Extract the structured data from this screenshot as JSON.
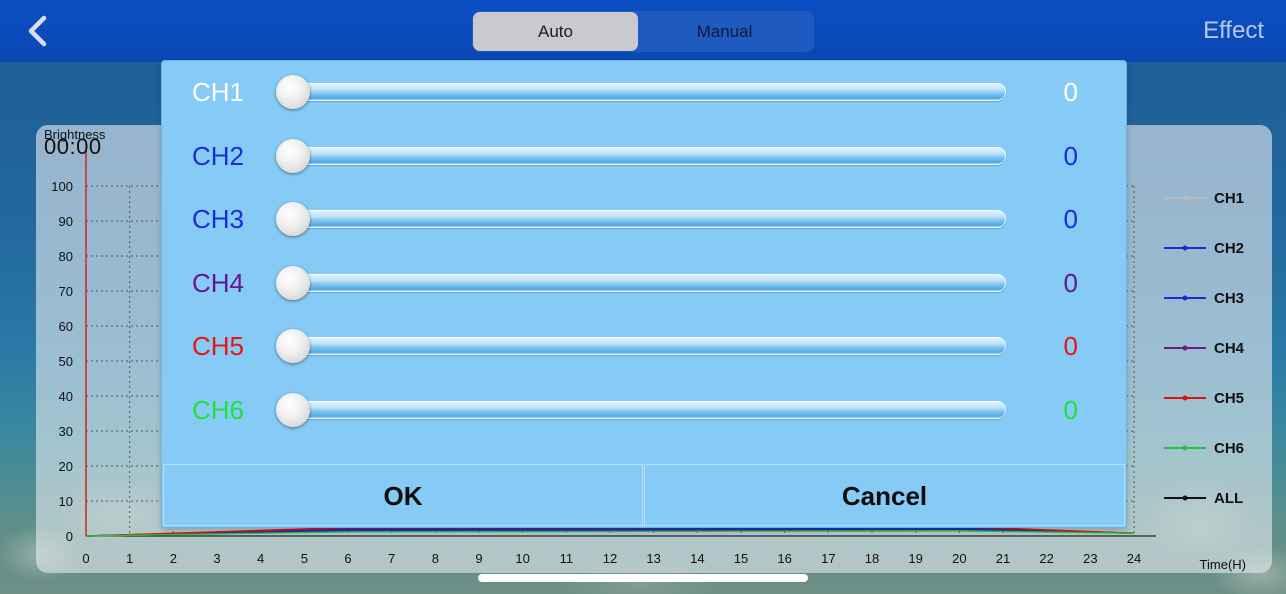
{
  "header": {
    "back_label": "<",
    "tabs": [
      {
        "label": "Auto",
        "active": true
      },
      {
        "label": "Manual",
        "active": false
      }
    ],
    "effect_label": "Effect"
  },
  "chart_data": {
    "type": "line",
    "ylabel": "Brightness",
    "xlabel": "Time(H)",
    "time_readout": "00:00",
    "x": [
      0,
      1,
      2,
      3,
      4,
      5,
      6,
      7,
      8,
      9,
      10,
      11,
      12,
      13,
      14,
      15,
      16,
      17,
      18,
      19,
      20,
      21,
      22,
      23,
      24
    ],
    "x_ticks": [
      "0",
      "1",
      "2",
      "3",
      "4",
      "5",
      "6",
      "7",
      "8",
      "9",
      "10",
      "11",
      "12",
      "13",
      "14",
      "15",
      "16",
      "17",
      "18",
      "19",
      "20",
      "21",
      "22",
      "23",
      "24"
    ],
    "y_ticks": [
      "0",
      "10",
      "20",
      "30",
      "40",
      "50",
      "60",
      "70",
      "80",
      "90",
      "100"
    ],
    "ylim": [
      0,
      100
    ],
    "xlim": [
      0,
      24
    ],
    "grid": true,
    "legend_position": "right",
    "series": [
      {
        "name": "CH1",
        "color": "#b9b9b9"
      },
      {
        "name": "CH2",
        "color": "#1a2bd0"
      },
      {
        "name": "CH3",
        "color": "#1a2bd0"
      },
      {
        "name": "CH4",
        "color": "#6a1a8a"
      },
      {
        "name": "CH5",
        "color": "#e01010"
      },
      {
        "name": "CH6",
        "color": "#23c23a"
      },
      {
        "name": "ALL",
        "color": "#111111"
      }
    ]
  },
  "dialog": {
    "channels": [
      {
        "name": "CH1",
        "value": "0",
        "level": 0,
        "color": "#ffffff"
      },
      {
        "name": "CH2",
        "value": "0",
        "level": 0,
        "color": "#1a2be0"
      },
      {
        "name": "CH3",
        "value": "0",
        "level": 0,
        "color": "#1a2be0"
      },
      {
        "name": "CH4",
        "value": "0",
        "level": 0,
        "color": "#6a1590"
      },
      {
        "name": "CH5",
        "value": "0",
        "level": 0,
        "color": "#ea1414"
      },
      {
        "name": "CH6",
        "value": "0",
        "level": 0,
        "color": "#22e03a"
      }
    ],
    "ok_label": "OK",
    "cancel_label": "Cancel"
  }
}
